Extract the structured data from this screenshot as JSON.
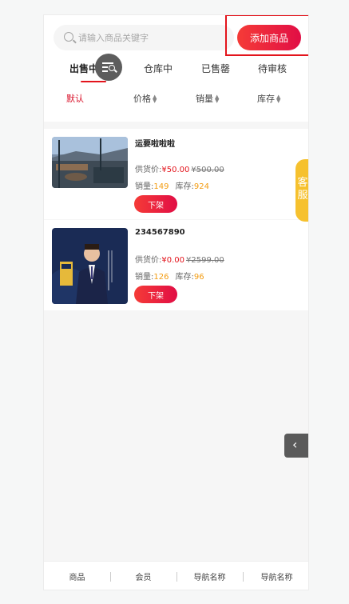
{
  "search": {
    "placeholder": "请输入商品关键字"
  },
  "header": {
    "add_label": "添加商品"
  },
  "tabs": [
    {
      "label": "出售中"
    },
    {
      "label": "仓库中"
    },
    {
      "label": "已售罄"
    },
    {
      "label": "待审核"
    }
  ],
  "sorts": [
    {
      "label": "默认"
    },
    {
      "label": "价格"
    },
    {
      "label": "销量"
    },
    {
      "label": "库存"
    }
  ],
  "products": [
    {
      "name": "运要啦啦啦",
      "price_label": "供货价:",
      "price": "¥50.00",
      "old_price": "¥500.00",
      "sales_label": "销量:",
      "sales": "149",
      "stock_label": "库存:",
      "stock": "924",
      "action": "下架"
    },
    {
      "name": "234567890",
      "price_label": "供货价:",
      "price": "¥0.00",
      "old_price": "¥2599.00",
      "sales_label": "销量:",
      "sales": "126",
      "stock_label": "库存:",
      "stock": "96",
      "action": "下架"
    }
  ],
  "service": {
    "label": "客服"
  },
  "bottom_nav": [
    {
      "label": "商品"
    },
    {
      "label": "会员"
    },
    {
      "label": "导航名称"
    },
    {
      "label": "导航名称"
    }
  ]
}
